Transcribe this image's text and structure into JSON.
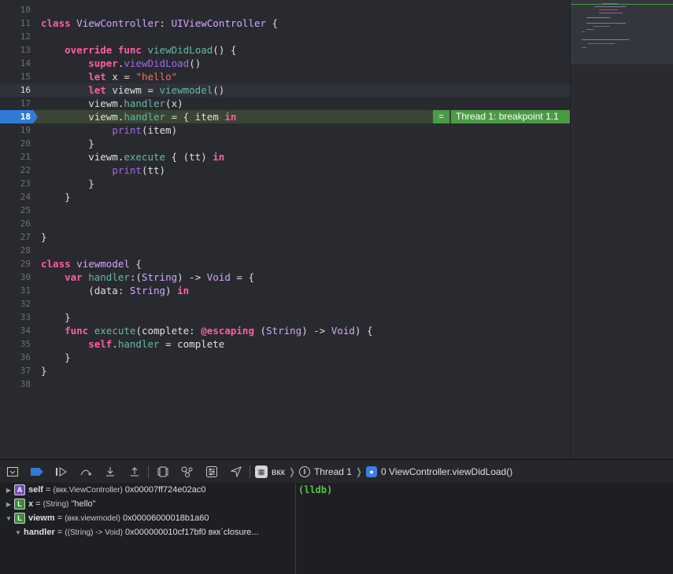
{
  "editor": {
    "lines": [
      {
        "n": "10",
        "html": ""
      },
      {
        "n": "11",
        "html": "<span class=\"k\">class</span> <span class=\"t\">ViewController</span>: <span class=\"t\">UIViewController</span> {"
      },
      {
        "n": "12",
        "html": ""
      },
      {
        "n": "13",
        "html": "    <span class=\"k\">override</span> <span class=\"k\">func</span> <span class=\"f\">viewDidLoad</span>() {"
      },
      {
        "n": "14",
        "html": "        <span class=\"k\">super</span>.<span class=\"m\">viewDidLoad</span>()"
      },
      {
        "n": "15",
        "html": "        <span class=\"k\">let</span> x = <span class=\"s\">\"hello\"</span>"
      },
      {
        "n": "16",
        "html": "        <span class=\"k\">let</span> viewm = <span class=\"f\">viewmodel</span>()"
      },
      {
        "n": "17",
        "html": "        viewm.<span class=\"f\">handler</span>(x)"
      },
      {
        "n": "18",
        "html": "        viewm.<span class=\"f\">handler</span> = { item <span class=\"k\">in</span>"
      },
      {
        "n": "19",
        "html": "            <span class=\"m\">print</span>(item)"
      },
      {
        "n": "20",
        "html": "        }"
      },
      {
        "n": "21",
        "html": "        viewm.<span class=\"f\">execute</span> { (tt) <span class=\"k\">in</span>"
      },
      {
        "n": "22",
        "html": "            <span class=\"m\">print</span>(tt)"
      },
      {
        "n": "23",
        "html": "        }"
      },
      {
        "n": "24",
        "html": "    }"
      },
      {
        "n": "25",
        "html": ""
      },
      {
        "n": "26",
        "html": ""
      },
      {
        "n": "27",
        "html": "}"
      },
      {
        "n": "28",
        "html": ""
      },
      {
        "n": "29",
        "html": "<span class=\"k\">class</span> <span class=\"t\">viewmodel</span> {"
      },
      {
        "n": "30",
        "html": "    <span class=\"k\">var</span> <span class=\"f\">handler</span>:(<span class=\"t\">String</span>) -> <span class=\"t\">Void</span> = {"
      },
      {
        "n": "31",
        "html": "        (data: <span class=\"t\">String</span>) <span class=\"k\">in</span>"
      },
      {
        "n": "32",
        "html": ""
      },
      {
        "n": "33",
        "html": "    }"
      },
      {
        "n": "34",
        "html": "    <span class=\"k\">func</span> <span class=\"f\">execute</span>(complete: <span class=\"k\">@escaping</span> (<span class=\"t\">String</span>) -> <span class=\"t\">Void</span>) {"
      },
      {
        "n": "35",
        "html": "        <span class=\"k\">self</span>.<span class=\"f\">handler</span> = complete"
      },
      {
        "n": "36",
        "html": "    }"
      },
      {
        "n": "37",
        "html": "}"
      },
      {
        "n": "38",
        "html": ""
      }
    ],
    "current_line": "16",
    "breakpoint_line": "18",
    "breakpoint_badge": {
      "eq": "=",
      "label": "Thread 1: breakpoint 1.1"
    }
  },
  "debugbar": {
    "app": "вкк",
    "thread": "Thread 1",
    "frame": "0 ViewController.viewDidLoad()"
  },
  "variables": [
    {
      "badge": "A",
      "name": "self",
      "eq": " = ",
      "type": "(вкк.ViewController)",
      "value": " 0x00007ff724e02ac0",
      "expand": "▶",
      "indent": 0
    },
    {
      "badge": "L",
      "name": "x",
      "eq": " = ",
      "type": "(String)",
      "value": " \"hello\"",
      "expand": "▶",
      "indent": 0
    },
    {
      "badge": "L",
      "name": "viewm",
      "eq": " = ",
      "type": "(вкк.viewmodel)",
      "value": " 0x00006000018b1a60",
      "expand": "▼",
      "indent": 0
    },
    {
      "badge": "",
      "name": "handler",
      "eq": " = ",
      "type": "((String) -> Void)",
      "value": " 0x000000010cf17bf0 вкк`closure...",
      "expand": "▼",
      "indent": 1
    }
  ],
  "console": {
    "prompt": "(lldb)"
  },
  "colors": {
    "breakpoint": "#2f7bd8",
    "badge_green": "#4b9a44",
    "keyword": "#fc5fa3",
    "string": "#fc6a5d",
    "type": "#d0a8ff"
  }
}
